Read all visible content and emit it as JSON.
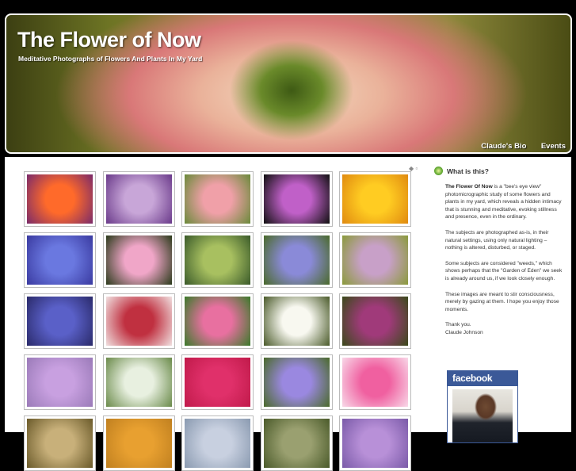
{
  "header": {
    "title": "The Flower of Now",
    "subtitle": "Meditative Photographs of Flowers And Plants In My Yard",
    "nav": [
      "Claude's Bio",
      "Events"
    ]
  },
  "gallery": {
    "controls": "◆ ▫",
    "thumbnails": [
      {
        "name": "poppy-photo",
        "colors": [
          "#ff6a2a",
          "#7a2a6a"
        ]
      },
      {
        "name": "purple-streaked-flower-photo",
        "colors": [
          "#c8a6d8",
          "#6a3a8a"
        ]
      },
      {
        "name": "pink-dogwood-photo",
        "colors": [
          "#f0a0a8",
          "#6a8a3a"
        ]
      },
      {
        "name": "purple-lily-photo",
        "colors": [
          "#c060c8",
          "#101010"
        ]
      },
      {
        "name": "yellow-flower-photo",
        "colors": [
          "#ffcc22",
          "#e08a10"
        ]
      },
      {
        "name": "blue-petals-photo",
        "colors": [
          "#6a78e0",
          "#3a3aa0"
        ]
      },
      {
        "name": "pink-camellia-photo",
        "colors": [
          "#f0a6c8",
          "#2a3a1a"
        ]
      },
      {
        "name": "green-stem-bud-photo",
        "colors": [
          "#a8c060",
          "#3a5a2a"
        ]
      },
      {
        "name": "blue-star-flowers-photo",
        "colors": [
          "#8a8ad8",
          "#4a6a2a"
        ]
      },
      {
        "name": "purple-deadnettle-photo",
        "colors": [
          "#c8a0c8",
          "#8a9a3a"
        ]
      },
      {
        "name": "grape-hyacinth-photo",
        "colors": [
          "#5a60c8",
          "#2a2a6a"
        ]
      },
      {
        "name": "red-white-flower-photo",
        "colors": [
          "#c03040",
          "#f0e0e0"
        ]
      },
      {
        "name": "pink-star-flower-photo",
        "colors": [
          "#e870a0",
          "#3a7a2a"
        ]
      },
      {
        "name": "white-dogwood-photo",
        "colors": [
          "#f8f8f0",
          "#4a5a2a"
        ]
      },
      {
        "name": "purple-clematis-photo",
        "colors": [
          "#a03a7a",
          "#3a4a1a"
        ]
      },
      {
        "name": "lilac-flower-photo",
        "colors": [
          "#c8a0e0",
          "#9a7ab8"
        ]
      },
      {
        "name": "snowdrop-photo",
        "colors": [
          "#e8f0e0",
          "#6a8a4a"
        ]
      },
      {
        "name": "red-rose-photo",
        "colors": [
          "#e0306a",
          "#c01a4a"
        ]
      },
      {
        "name": "balloon-flower-photo",
        "colors": [
          "#9a88e0",
          "#4a6a2a"
        ]
      },
      {
        "name": "pink-lily-photo",
        "colors": [
          "#f060a0",
          "#f8d8e8"
        ]
      },
      {
        "name": "partial-photo-1",
        "colors": [
          "#c8b07a",
          "#6a5a2a"
        ]
      },
      {
        "name": "partial-photo-2",
        "colors": [
          "#e8a030",
          "#c08020"
        ]
      },
      {
        "name": "partial-photo-3",
        "colors": [
          "#c8d0e0",
          "#8a9ab0"
        ]
      },
      {
        "name": "partial-photo-4",
        "colors": [
          "#9aa070",
          "#4a5a2a"
        ]
      },
      {
        "name": "partial-photo-5",
        "colors": [
          "#b890d8",
          "#7a5aa8"
        ]
      }
    ]
  },
  "sidebar": {
    "heading": "What is this?",
    "para1_bold": "The Flower Of Now",
    "para1_rest": " is a \"bee's eye view\" photomicrographic study of some flowers and plants in my yard, which reveals a hidden intimacy that is stunning and meditative, evoking stillness and presence, even in the ordinary.",
    "para2": "The subjects are photographed as-is, in their natural settings, using only natural lighting – nothing is altered, disturbed, or staged.",
    "para3": "Some subjects are considered \"weeds,\" which shows perhaps that the \"Garden of Eden\" we seek is already around us, if we look closely enough.",
    "para4": "These images are meant to stir consciousness, merely by gazing at them. I hope you enjoy those moments.",
    "thanks": "Thank you.",
    "signature": "Claude Johnson",
    "facebook_label": "facebook"
  }
}
